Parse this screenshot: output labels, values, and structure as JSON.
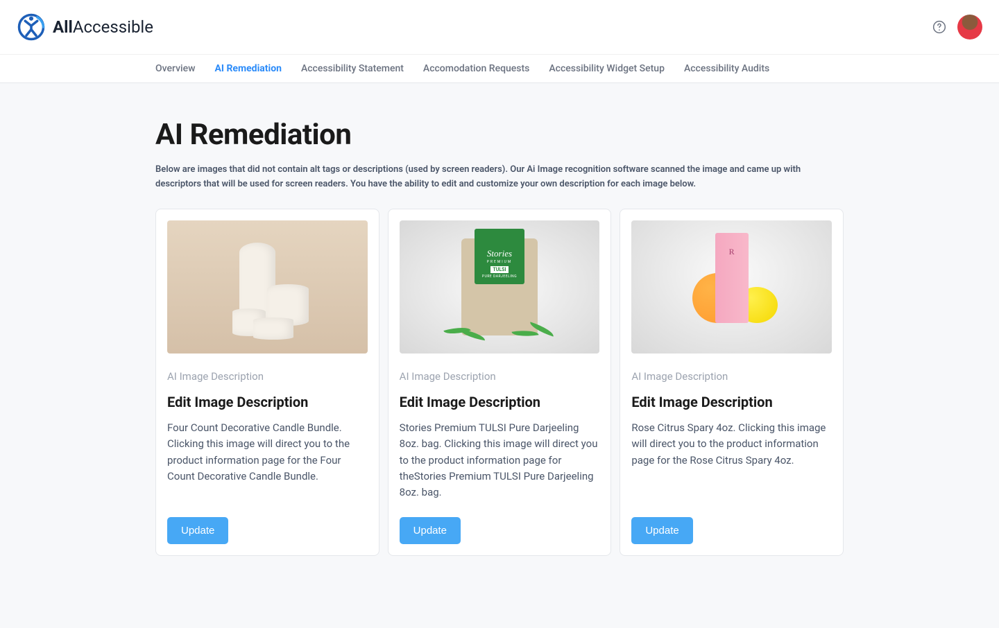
{
  "header": {
    "logo_text_bold": "All",
    "logo_text_light": "Accessible"
  },
  "nav": {
    "items": [
      {
        "label": "Overview",
        "active": false
      },
      {
        "label": "AI Remediation",
        "active": true
      },
      {
        "label": "Accessibility Statement",
        "active": false
      },
      {
        "label": "Accomodation Requests",
        "active": false
      },
      {
        "label": "Accessibility Widget Setup",
        "active": false
      },
      {
        "label": "Accessibility Audits",
        "active": false
      }
    ]
  },
  "page": {
    "title": "AI Remediation",
    "description": "Below are images that did not contain alt tags or descriptions (used by screen readers). Our Ai Image recognition software scanned the image and came up with descriptors that will be used for screen readers. You have the ability to edit and customize your own description for each image below."
  },
  "card_label": "AI Image Description",
  "card_title": "Edit Image Description",
  "update_button": "Update",
  "cards": [
    {
      "description": "Four Count Decorative Candle Bundle. Clicking this image will direct you to the product information page for the Four Count Decorative Candle Bundle."
    },
    {
      "description": "Stories Premium TULSI Pure Darjeeling 8oz. bag. Clicking this image will direct you to the product information page for theStories Premium TULSI Pure Darjeeling 8oz. bag."
    },
    {
      "description": "Rose Citrus Spary 4oz. Clicking this image will direct you to the product information page for the Rose Citrus Spary 4oz."
    }
  ],
  "tea_label": {
    "brand": "Stories",
    "premium": "PREMIUM",
    "type": "TULSI",
    "sub": "PURE DARJEELING"
  },
  "pink_box_text": "R"
}
